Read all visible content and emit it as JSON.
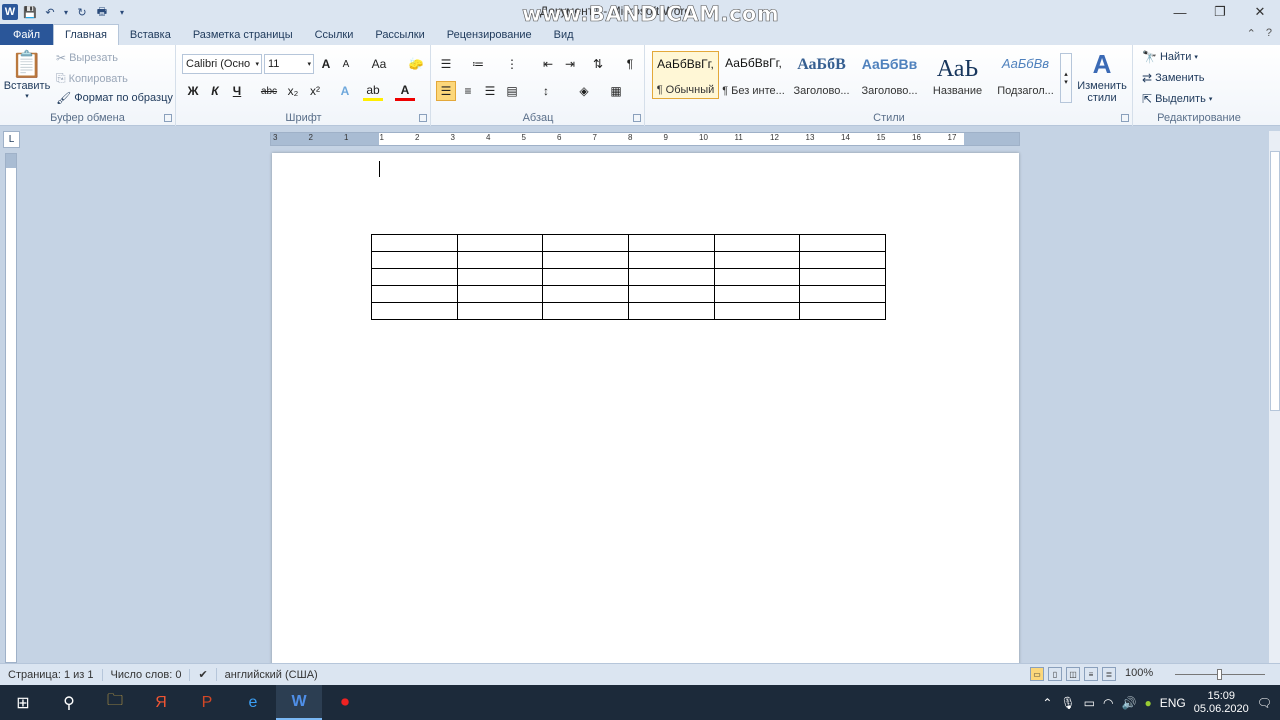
{
  "window": {
    "title": "Документ1 - Microsoft Word",
    "watermark": "www.BANDICAM.com",
    "controls": [
      "—",
      "❐",
      "✕"
    ]
  },
  "qat": {
    "save": "save-icon",
    "undo": "undo-icon",
    "redo": "redo-icon",
    "print": "print-icon"
  },
  "tabs": [
    {
      "label": "Файл"
    },
    {
      "label": "Главная"
    },
    {
      "label": "Вставка"
    },
    {
      "label": "Разметка страницы"
    },
    {
      "label": "Ссылки"
    },
    {
      "label": "Рассылки"
    },
    {
      "label": "Рецензирование"
    },
    {
      "label": "Вид"
    }
  ],
  "ribbon": {
    "clipboard": {
      "label": "Буфер обмена",
      "paste": "Вставить",
      "cut": "Вырезать",
      "copy": "Копировать",
      "format_painter": "Формат по образцу"
    },
    "font": {
      "label": "Шрифт",
      "font_name": "Calibri (Осно",
      "font_size": "11",
      "bold": "Ж",
      "italic": "К",
      "underline": "Ч",
      "strike": "abc",
      "sub": "x₂",
      "sup": "x²",
      "grow": "A",
      "shrink": "A",
      "case": "Aa"
    },
    "paragraph": {
      "label": "Абзац"
    },
    "styles": {
      "label": "Стили",
      "items": [
        {
          "sample": "АаБбВвГг,",
          "name": "¶ Обычный"
        },
        {
          "sample": "АаБбВвГг,",
          "name": "¶ Без инте..."
        },
        {
          "sample": "АаБбВ",
          "name": "Заголово..."
        },
        {
          "sample": "АаБбВв",
          "name": "Заголово..."
        },
        {
          "sample": "АаЬ",
          "name": "Название"
        },
        {
          "sample": "АаБбВв",
          "name": "Подзагол..."
        }
      ],
      "change_styles": "Изменить стили"
    },
    "editing": {
      "label": "Редактирование",
      "find": "Найти",
      "replace": "Заменить",
      "select": "Выделить"
    }
  },
  "ruler": {
    "numbers": [
      "3",
      "2",
      "1",
      "1",
      "2",
      "3",
      "4",
      "5",
      "6",
      "7",
      "8",
      "9",
      "10",
      "11",
      "12",
      "13",
      "14",
      "15",
      "16",
      "17"
    ]
  },
  "document": {
    "table": {
      "rows": 5,
      "cols": 6
    }
  },
  "status": {
    "page": "Страница: 1 из 1",
    "words": "Число слов: 0",
    "language": "английский (США)",
    "zoom": "100%"
  },
  "taskbar": {
    "lang": "ENG",
    "time": "15:09",
    "date": "05.06.2020"
  }
}
